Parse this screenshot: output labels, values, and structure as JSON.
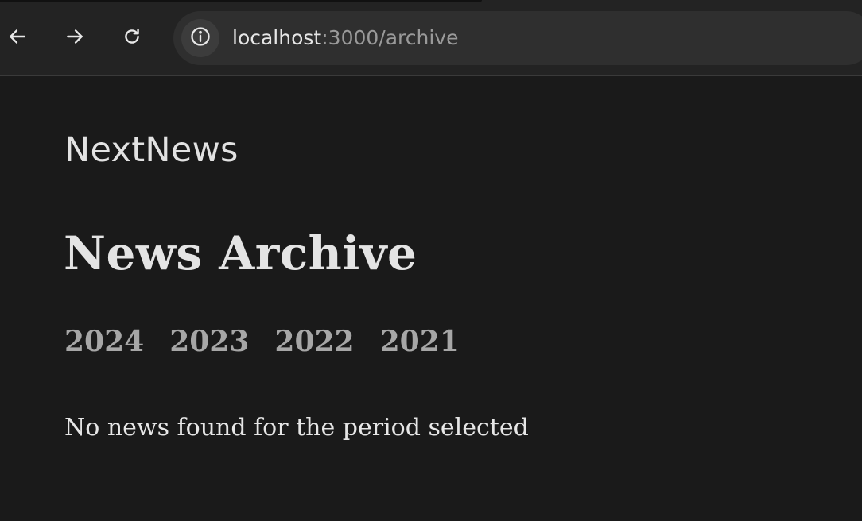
{
  "browser": {
    "icons": {
      "back": "arrow-left-icon",
      "forward": "arrow-right-icon",
      "reload": "reload-icon",
      "site_info": "info-icon"
    },
    "url_host": "localhost",
    "url_rest": ":3000/archive"
  },
  "header": {
    "brand": "NextNews"
  },
  "main": {
    "title": "News Archive",
    "years": [
      "2024",
      "2023",
      "2022",
      "2021"
    ],
    "empty_message": "No news found for the period selected"
  },
  "colors": {
    "page_background": "#1a1a1a",
    "browser_chrome": "#232323",
    "address_bar": "#2f2f2f",
    "primary_text": "#e4e4e4",
    "year_link_text": "#a6a6a6",
    "url_secondary_text": "#9a9a9a"
  }
}
